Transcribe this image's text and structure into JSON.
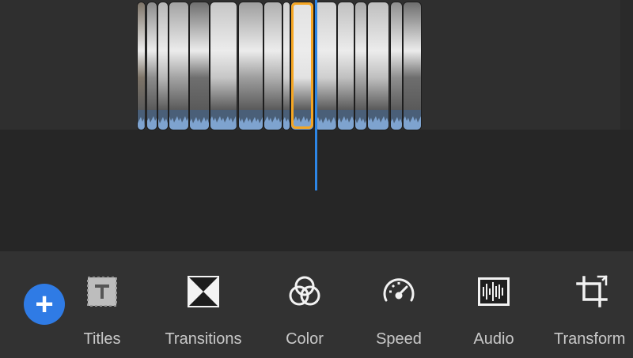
{
  "timeline": {
    "clips": [
      {
        "name": "clip-1",
        "tone": "#7d7468"
      },
      {
        "name": "clip-2",
        "tone": "#8c8c8c"
      },
      {
        "name": "clip-3",
        "tone": "#b7b7b7"
      },
      {
        "name": "clip-4",
        "tone": "#a3a3a3"
      },
      {
        "name": "clip-5",
        "tone": "#6f6f6f"
      },
      {
        "name": "clip-6",
        "tone": "#c6c6c6"
      },
      {
        "name": "clip-7",
        "tone": "#9e9e9e"
      },
      {
        "name": "clip-8",
        "tone": "#b0b0b0"
      },
      {
        "name": "clip-9",
        "tone": "#d0d0d0"
      },
      {
        "name": "clip-10",
        "tone": "#e2e2e2"
      },
      {
        "name": "clip-11",
        "tone": "#cfcfcf"
      },
      {
        "name": "clip-12",
        "tone": "#c0c0c0"
      },
      {
        "name": "clip-13",
        "tone": "#a9a9a9"
      },
      {
        "name": "clip-14",
        "tone": "#bfbfbf"
      },
      {
        "name": "clip-15",
        "tone": "#8f8f8f"
      },
      {
        "name": "clip-16",
        "tone": "#6e6e6e"
      }
    ],
    "selected_color": "#f5a623",
    "playhead_color": "#2d86e6"
  },
  "toolbar": {
    "add_label": "+",
    "tools": [
      {
        "label": "Titles",
        "icon": "titles-icon"
      },
      {
        "label": "Transitions",
        "icon": "transitions-icon"
      },
      {
        "label": "Color",
        "icon": "color-icon"
      },
      {
        "label": "Speed",
        "icon": "speed-icon"
      },
      {
        "label": "Audio",
        "icon": "audio-icon"
      },
      {
        "label": "Transform",
        "icon": "transform-icon"
      }
    ]
  }
}
